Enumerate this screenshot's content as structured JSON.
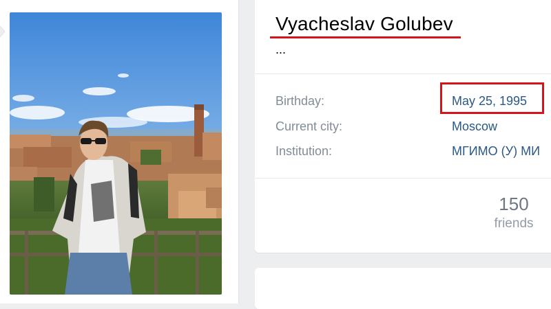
{
  "profile": {
    "name": "Vyacheslav Golubev",
    "status": "...",
    "rows": [
      {
        "label": "Birthday:",
        "value": "May 25, 1995"
      },
      {
        "label": "Current city:",
        "value": "Moscow"
      },
      {
        "label": "Institution:",
        "value": "МГИМО (У) МИ"
      }
    ]
  },
  "counters": {
    "friends_count": "150",
    "friends_label": "friends"
  },
  "colors": {
    "link": "#2a5885",
    "label": "#818c99",
    "annotation": "#d4141b",
    "background": "#edeef0"
  },
  "photo": {
    "icon": "profile-photo"
  }
}
